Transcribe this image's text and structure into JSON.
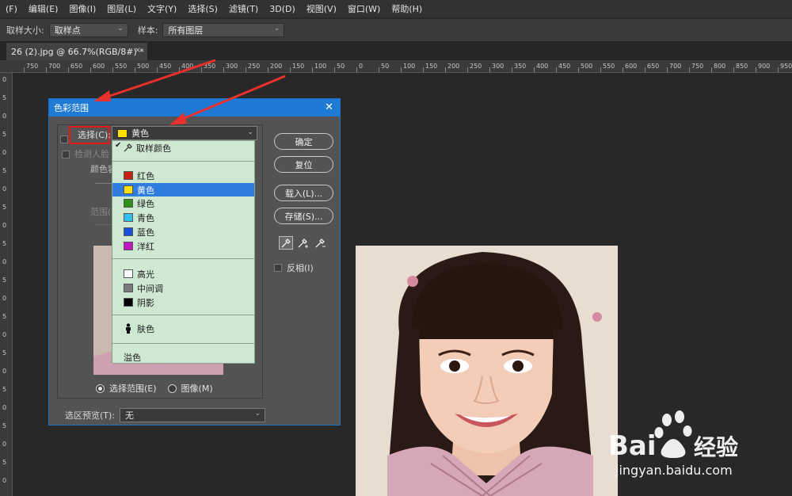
{
  "menu": [
    "(F)",
    "编辑(E)",
    "图像(I)",
    "图层(L)",
    "文字(Y)",
    "选择(S)",
    "滤镜(T)",
    "3D(D)",
    "视图(V)",
    "窗口(W)",
    "帮助(H)"
  ],
  "options": {
    "sample_size_label": "取样大小:",
    "sample_size_value": "取样点",
    "sample_label": "样本:",
    "sample_value": "所有图层"
  },
  "doc_tab": {
    "title": "26 (2).jpg @ 66.7%(RGB/8#) *",
    "close": "×"
  },
  "ruler_h": [
    "750",
    "700",
    "650",
    "600",
    "550",
    "500",
    "450",
    "400",
    "350",
    "300",
    "250",
    "200",
    "150",
    "100",
    "50",
    "0",
    "50",
    "100",
    "150",
    "200",
    "250",
    "300",
    "350",
    "400",
    "450",
    "500",
    "550",
    "600",
    "650",
    "700",
    "750",
    "800",
    "850",
    "900",
    "950"
  ],
  "ruler_v": [
    "0",
    "5",
    "0",
    "5",
    "0",
    "5",
    "0",
    "5",
    "0",
    "5",
    "0",
    "5",
    "0",
    "5",
    "0",
    "5",
    "0",
    "5",
    "0",
    "5",
    "0",
    "5",
    "0"
  ],
  "dialog": {
    "title": "色彩范围",
    "close": "✕",
    "select_label": "选择(C):",
    "select_value": "黄色",
    "select_color": "#ffe100",
    "detect_faces": "检测人脸",
    "fuzziness": "颜色容",
    "range": "范围(",
    "buttons": {
      "ok": "确定",
      "reset": "复位",
      "load": "载入(L)...",
      "save": "存储(S)..."
    },
    "invert": "反相(I)",
    "radio_selection": "选择范围(E)",
    "radio_image": "图像(M)",
    "preview_label": "选区预览(T):",
    "preview_value": "无"
  },
  "dropdown": {
    "sampled": "取样颜色",
    "reds": "红色",
    "reds_color": "#c4220e",
    "yellows": "黄色",
    "yellows_color": "#ffe100",
    "greens": "绿色",
    "greens_color": "#2e8f1a",
    "cyans": "青色",
    "cyans_color": "#2fc0f0",
    "blues": "蓝色",
    "blues_color": "#1a4fd8",
    "magentas": "洋红",
    "magentas_color": "#c218c0",
    "highlights": "高光",
    "highlights_color": "#ffffff",
    "midtones": "中间调",
    "midtones_color": "#7a7a7a",
    "shadows": "阴影",
    "shadows_color": "#000000",
    "skin": "肤色",
    "out_of_gamut": "溢色"
  },
  "watermark": {
    "brand": "Bai",
    "brand2": "经验",
    "url": "jingyan.baidu.com"
  }
}
